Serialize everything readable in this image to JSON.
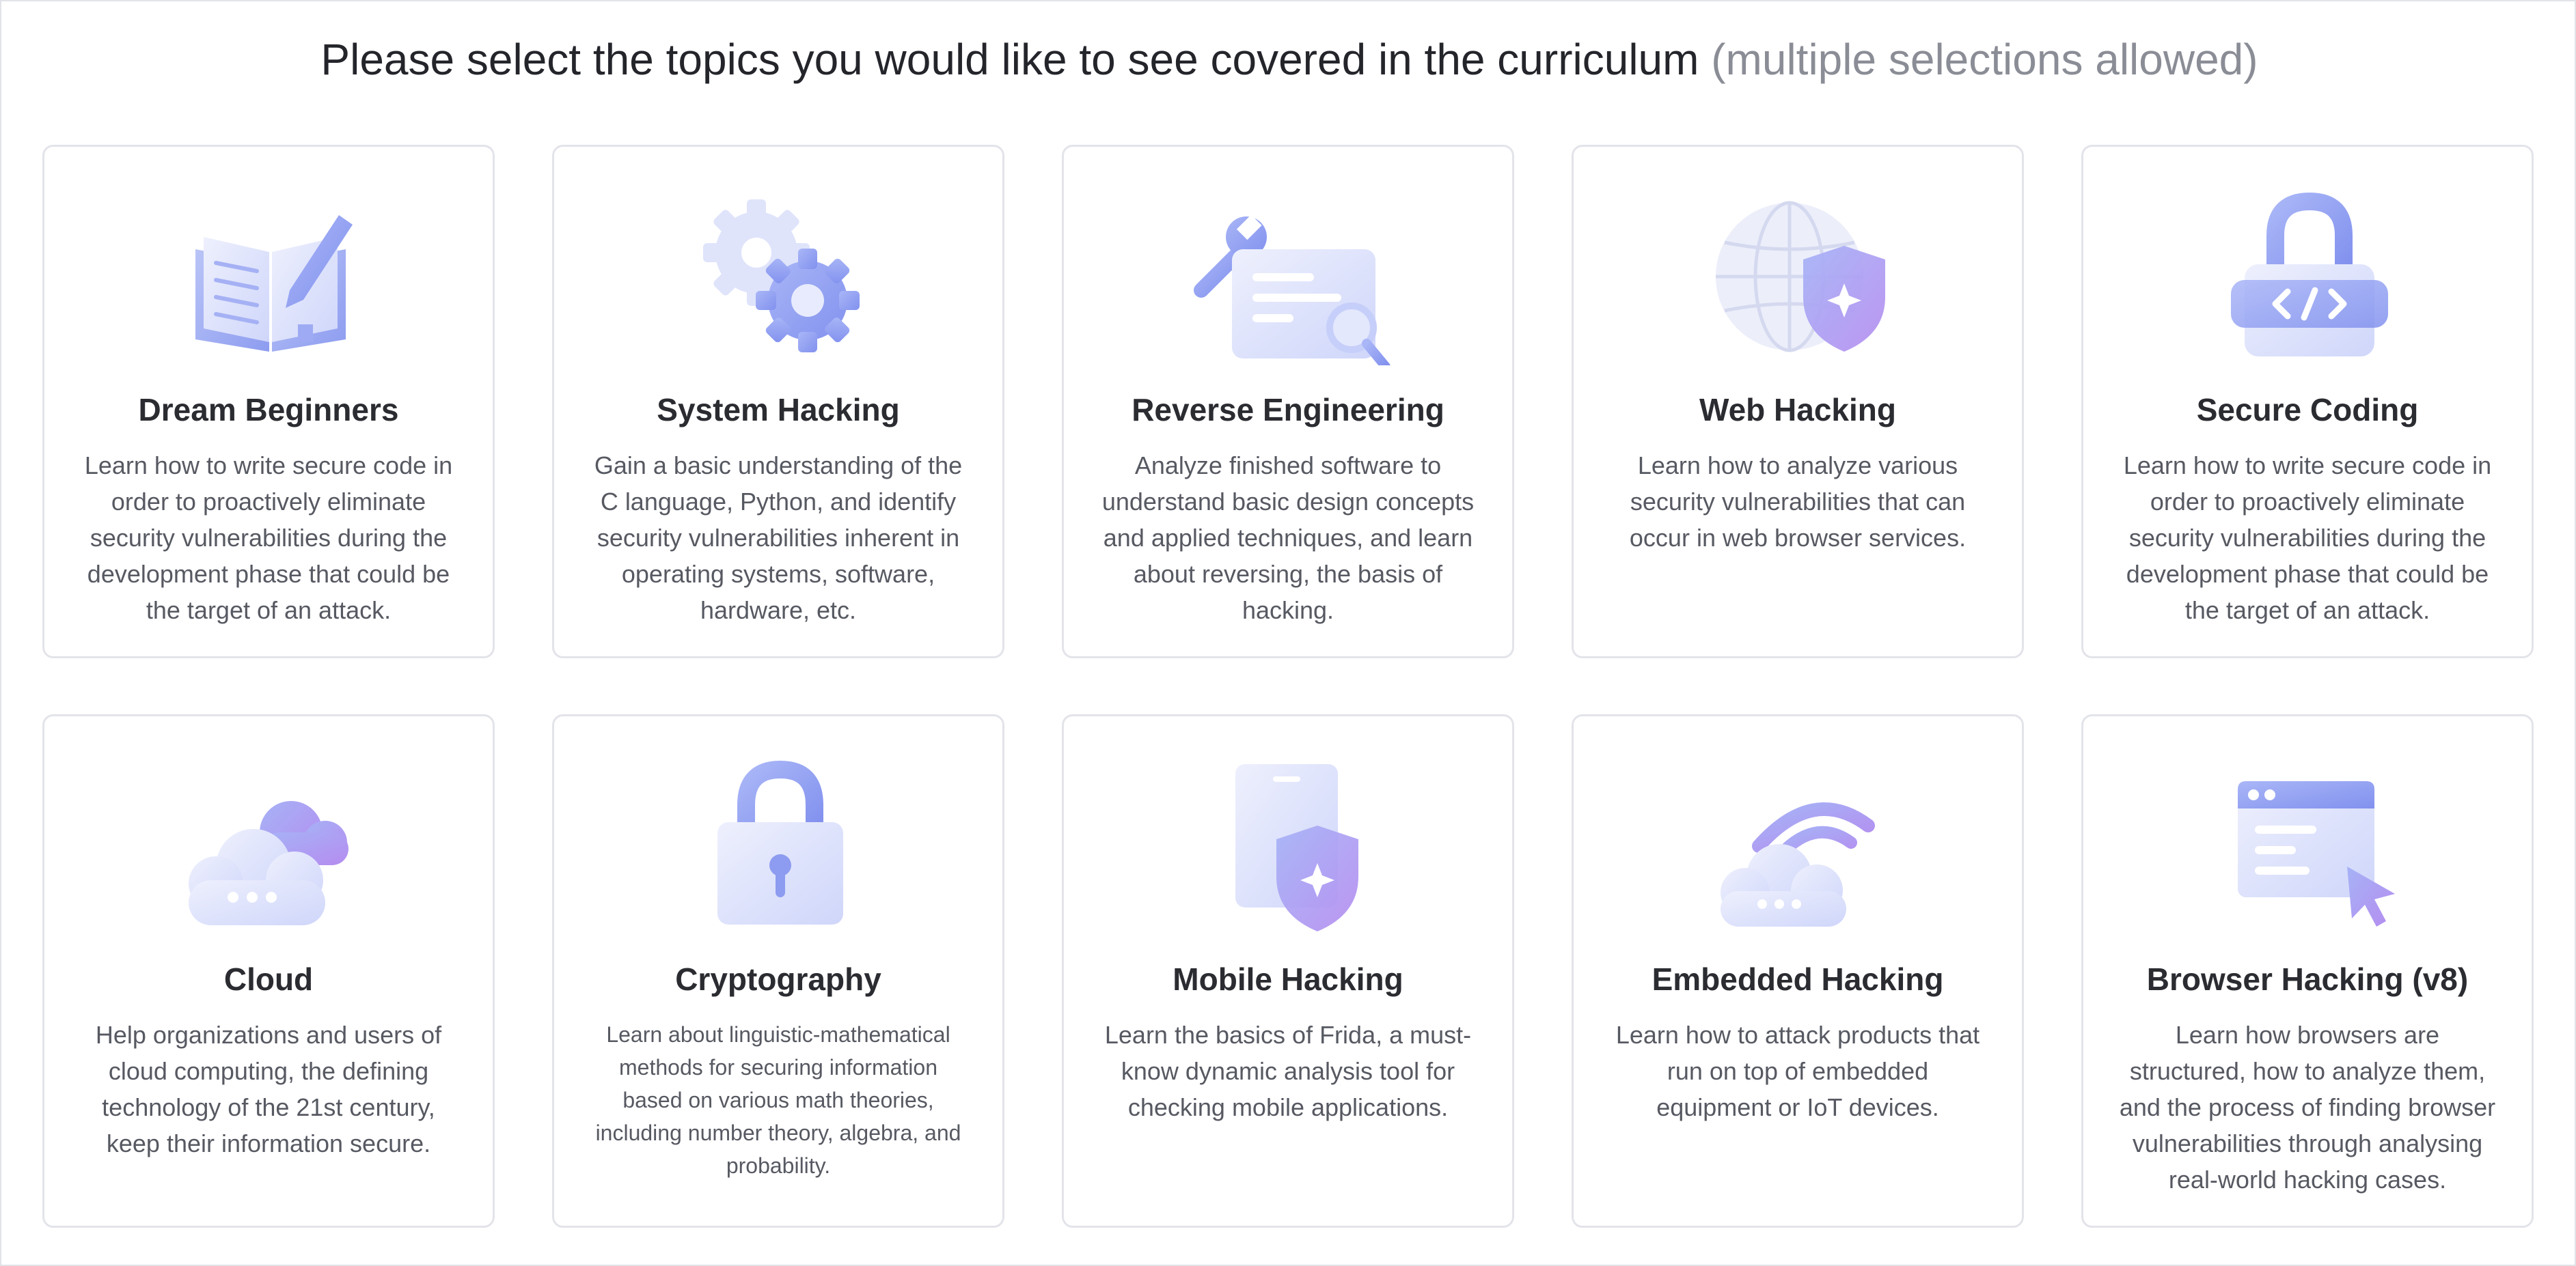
{
  "heading": {
    "main": "Please select the topics you would like to see covered in the curriculum",
    "hint": "(multiple selections allowed)"
  },
  "topics": [
    {
      "icon": "book-pencil-icon",
      "title": "Dream Beginners",
      "description": "Learn how to write secure code in order to proactively eliminate security vulnerabilities during the development phase that could be the target of an attack."
    },
    {
      "icon": "gears-icon",
      "title": "System Hacking",
      "description": "Gain a basic understanding of the C language, Python, and identify security vulnerabilities inherent in operating systems, software, hardware, etc."
    },
    {
      "icon": "wrench-document-icon",
      "title": "Reverse Engineering",
      "description": "Analyze finished software to understand basic design concepts and applied techniques, and learn about reversing, the basis of hacking."
    },
    {
      "icon": "globe-shield-icon",
      "title": "Web Hacking",
      "description": "Learn how to analyze various security vulnerabilities that can occur in web browser services."
    },
    {
      "icon": "code-lock-icon",
      "title": "Secure Coding",
      "description": "Learn how to write secure code in order to proactively eliminate security vulnerabilities during the development phase that could be the target of an attack."
    },
    {
      "icon": "cloud-icon",
      "title": "Cloud",
      "description": "Help organizations and users of cloud computing, the defining technology of the 21st century, keep their information secure."
    },
    {
      "icon": "padlock-icon",
      "title": "Cryptography",
      "description": "Learn about linguistic-mathematical methods for securing information based on various math theories, including number theory, algebra, and probability."
    },
    {
      "icon": "phone-shield-icon",
      "title": "Mobile Hacking",
      "description": "Learn the basics of Frida, a must-know dynamic analysis tool for checking mobile applications."
    },
    {
      "icon": "cloud-wifi-icon",
      "title": "Embedded Hacking",
      "description": "Learn how to attack products that run on top of embedded equipment or IoT devices."
    },
    {
      "icon": "browser-cursor-icon",
      "title": "Browser Hacking (v8)",
      "description": "Learn how browsers are structured, how to analyze them, and the process of finding browser vulnerabilities through analysing real-world hacking cases."
    }
  ]
}
